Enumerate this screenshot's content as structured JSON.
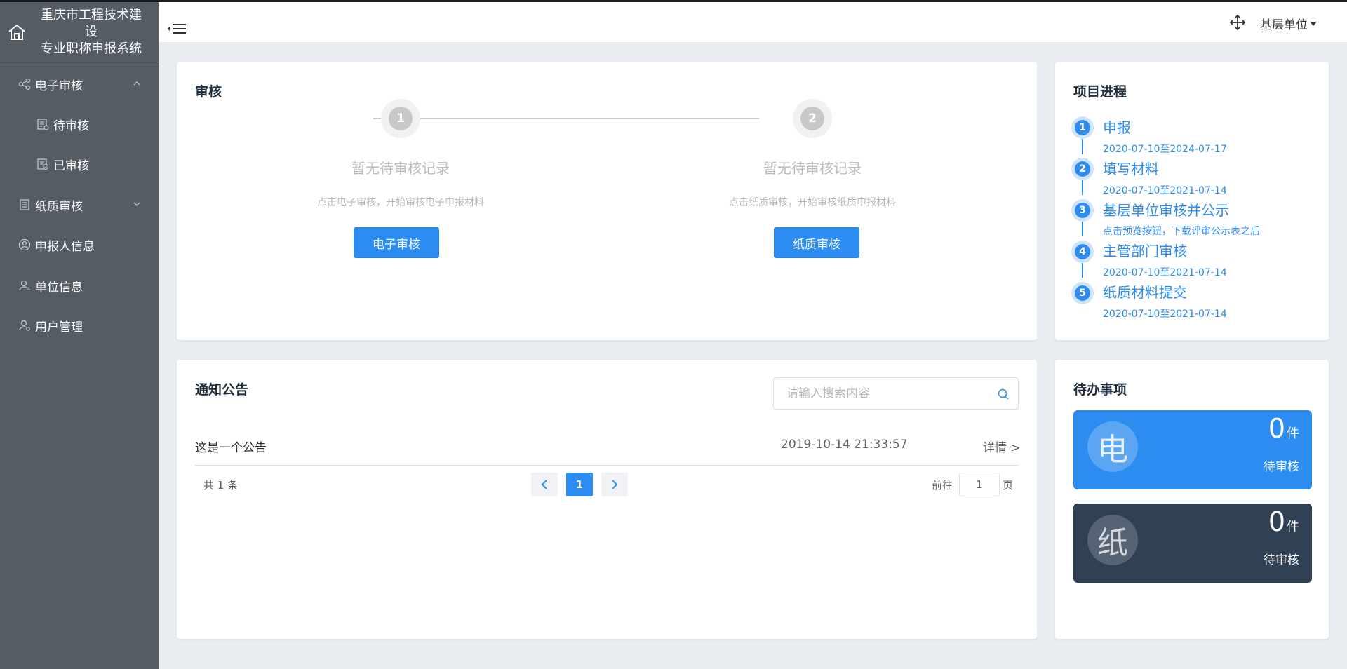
{
  "app": {
    "title_line1": "重庆市工程技术建设",
    "title_line2": "专业职称申报系统"
  },
  "sidebar": {
    "items": [
      {
        "label": "电子审核",
        "icon": "share-icon",
        "expanded": true
      },
      {
        "label": "待审核",
        "icon": "doc-list-icon"
      },
      {
        "label": "已审核",
        "icon": "doc-check-icon"
      },
      {
        "label": "纸质审核",
        "icon": "paper-doc-icon",
        "expanded": false
      },
      {
        "label": "申报人信息",
        "icon": "user-circle-icon"
      },
      {
        "label": "单位信息",
        "icon": "user-search-icon"
      },
      {
        "label": "用户管理",
        "icon": "user-gear-icon"
      }
    ]
  },
  "header": {
    "user_label": "基层单位"
  },
  "audit": {
    "title": "审核",
    "steps": [
      {
        "num": "1",
        "empty_title": "暂无待审核记录",
        "desc": "点击电子审核，开始审核电子申报材料",
        "button": "电子审核"
      },
      {
        "num": "2",
        "empty_title": "暂无待审核记录",
        "desc": "点击纸质审核，开始审核纸质申报材料",
        "button": "纸质审核"
      }
    ]
  },
  "progress": {
    "title": "项目进程",
    "items": [
      {
        "num": "1",
        "title": "申报",
        "date": "2020-07-10至2024-07-17"
      },
      {
        "num": "2",
        "title": "填写材料",
        "date": "2020-07-10至2021-07-14"
      },
      {
        "num": "3",
        "title": "基层单位审核并公示",
        "date": "点击预览按钮，下载评审公示表之后"
      },
      {
        "num": "4",
        "title": "主管部门审核",
        "date": "2020-07-10至2021-07-14"
      },
      {
        "num": "5",
        "title": "纸质材料提交",
        "date": "2020-07-10至2021-07-14"
      }
    ]
  },
  "notice": {
    "title": "通知公告",
    "search_placeholder": "请输入搜索内容",
    "rows": [
      {
        "text": "这是一个公告",
        "time": "2019-10-14 21:33:57",
        "more": "详情 >"
      }
    ],
    "pagination": {
      "total": "共 1 条",
      "current": "1",
      "goto_label": "前往",
      "goto_value": "1",
      "page_unit": "页"
    }
  },
  "todo": {
    "title": "待办事项",
    "items": [
      {
        "badge": "电",
        "count": "0",
        "unit": "件",
        "label": "待审核",
        "color": "#2d8cf0"
      },
      {
        "badge": "纸",
        "count": "0",
        "unit": "件",
        "label": "待审核",
        "color": "#304156"
      }
    ]
  },
  "colors": {
    "primary": "#2d8cf0",
    "sidebar_bg": "#545c64",
    "dark_card": "#304156",
    "page_bg": "#e9edf2"
  }
}
